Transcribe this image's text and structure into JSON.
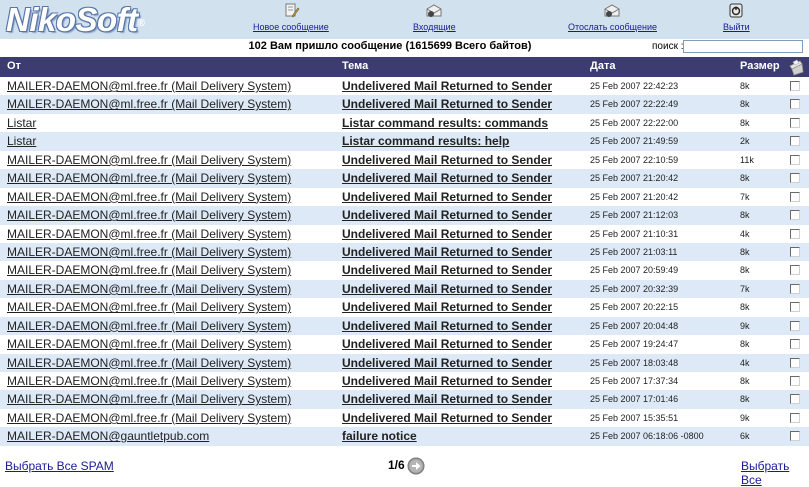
{
  "app": {
    "logo": "NikoSoft",
    "logo_mark": "®"
  },
  "nav": {
    "new_message": "Новое сообщение",
    "inbox": "Входящие",
    "send_message": "Отослать сообщение",
    "logout": "Выйти"
  },
  "infobar": {
    "message_count": "102 Вам пришло сообщение (1615699 Всего байтов)",
    "search_label": "поиск :",
    "search_value": ""
  },
  "table": {
    "headers": {
      "from": "От",
      "subject": "Тема",
      "date": "Дата",
      "size": "Размер"
    },
    "rows": [
      {
        "from": "MAILER-DAEMON@ml.free.fr (Mail Delivery System)",
        "subject": "Undelivered Mail Returned to Sender",
        "date": "25 Feb 2007 22:42:23",
        "size": "8k"
      },
      {
        "from": "MAILER-DAEMON@ml.free.fr (Mail Delivery System)",
        "subject": "Undelivered Mail Returned to Sender",
        "date": "25 Feb 2007 22:22:49",
        "size": "8k"
      },
      {
        "from": "Listar",
        "subject": "Listar command results: commands",
        "date": "25 Feb 2007 22:22:00",
        "size": "8k"
      },
      {
        "from": "Listar",
        "subject": "Listar command results: help",
        "date": "25 Feb 2007 21:49:59",
        "size": "2k"
      },
      {
        "from": "MAILER-DAEMON@ml.free.fr (Mail Delivery System)",
        "subject": "Undelivered Mail Returned to Sender",
        "date": "25 Feb 2007 22:10:59",
        "size": "11k"
      },
      {
        "from": "MAILER-DAEMON@ml.free.fr (Mail Delivery System)",
        "subject": "Undelivered Mail Returned to Sender",
        "date": "25 Feb 2007 21:20:42",
        "size": "8k"
      },
      {
        "from": "MAILER-DAEMON@ml.free.fr (Mail Delivery System)",
        "subject": "Undelivered Mail Returned to Sender",
        "date": "25 Feb 2007 21:20:42",
        "size": "7k"
      },
      {
        "from": "MAILER-DAEMON@ml.free.fr (Mail Delivery System)",
        "subject": "Undelivered Mail Returned to Sender",
        "date": "25 Feb 2007 21:12:03",
        "size": "8k"
      },
      {
        "from": "MAILER-DAEMON@ml.free.fr (Mail Delivery System)",
        "subject": "Undelivered Mail Returned to Sender",
        "date": "25 Feb 2007 21:10:31",
        "size": "4k"
      },
      {
        "from": "MAILER-DAEMON@ml.free.fr (Mail Delivery System)",
        "subject": "Undelivered Mail Returned to Sender",
        "date": "25 Feb 2007 21:03:11",
        "size": "8k"
      },
      {
        "from": "MAILER-DAEMON@ml.free.fr (Mail Delivery System)",
        "subject": "Undelivered Mail Returned to Sender",
        "date": "25 Feb 2007 20:59:49",
        "size": "8k"
      },
      {
        "from": "MAILER-DAEMON@ml.free.fr (Mail Delivery System)",
        "subject": "Undelivered Mail Returned to Sender",
        "date": "25 Feb 2007 20:32:39",
        "size": "7k"
      },
      {
        "from": "MAILER-DAEMON@ml.free.fr (Mail Delivery System)",
        "subject": "Undelivered Mail Returned to Sender",
        "date": "25 Feb 2007 20:22:15",
        "size": "8k"
      },
      {
        "from": "MAILER-DAEMON@ml.free.fr (Mail Delivery System)",
        "subject": "Undelivered Mail Returned to Sender",
        "date": "25 Feb 2007 20:04:48",
        "size": "9k"
      },
      {
        "from": "MAILER-DAEMON@ml.free.fr (Mail Delivery System)",
        "subject": "Undelivered Mail Returned to Sender",
        "date": "25 Feb 2007 19:24:47",
        "size": "8k"
      },
      {
        "from": "MAILER-DAEMON@ml.free.fr (Mail Delivery System)",
        "subject": "Undelivered Mail Returned to Sender",
        "date": "25 Feb 2007 18:03:48",
        "size": "4k"
      },
      {
        "from": "MAILER-DAEMON@ml.free.fr (Mail Delivery System)",
        "subject": "Undelivered Mail Returned to Sender",
        "date": "25 Feb 2007 17:37:34",
        "size": "8k"
      },
      {
        "from": "MAILER-DAEMON@ml.free.fr (Mail Delivery System)",
        "subject": "Undelivered Mail Returned to Sender",
        "date": "25 Feb 2007 17:01:46",
        "size": "8k"
      },
      {
        "from": "MAILER-DAEMON@ml.free.fr (Mail Delivery System)",
        "subject": "Undelivered Mail Returned to Sender",
        "date": "25 Feb 2007 15:35:51",
        "size": "9k"
      },
      {
        "from": "MAILER-DAEMON@gauntletpub.com",
        "subject": "failure notice",
        "date": "25 Feb 2007 06:18:06 -0800",
        "size": "6k"
      }
    ]
  },
  "footer": {
    "select_all_spam": "Выбрать Все SPAM",
    "page": "1/6",
    "select_all": "Выбрать Все"
  },
  "colors": {
    "topbar": "#d2e1ee",
    "header_bg": "#3c3c70",
    "alt_row": "#dde9f6",
    "link": "#1a1a99"
  },
  "icons": {
    "new_message": "compose-icon",
    "inbox": "inbox-envelope-icon",
    "send_message": "send-envelope-icon",
    "logout": "power-icon",
    "delete": "trash-icon",
    "next_page": "arrow-right-circle-icon"
  }
}
